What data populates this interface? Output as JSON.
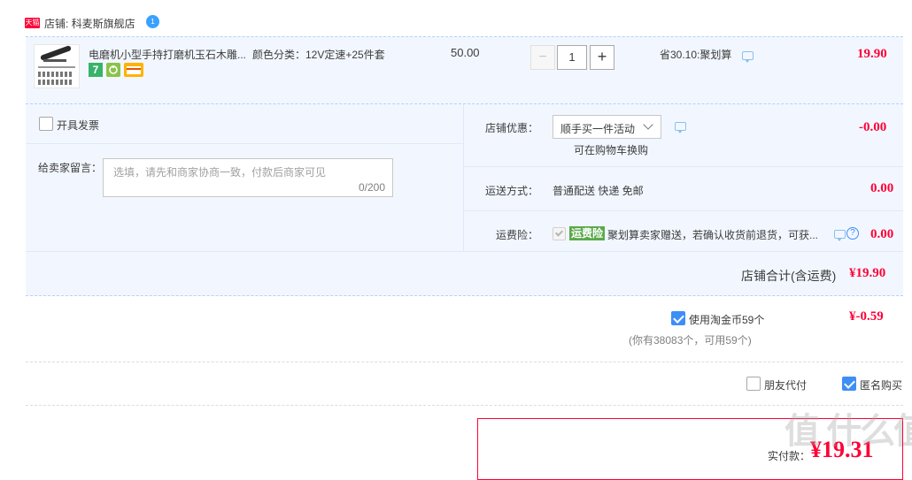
{
  "shop": {
    "badge": "天猫",
    "name": "店铺: 科麦斯旗舰店",
    "chat_bubble": "1"
  },
  "item": {
    "title": "电磨机小型手持打磨机玉石木雕...",
    "sku": "颜色分类：12V定速+25件套",
    "unit_price": "50.00",
    "quantity": "1",
    "minus": "−",
    "plus": "+",
    "promo": "省30.10:聚划算",
    "subtotal": "19.90",
    "service_badge_1": "7"
  },
  "invoice": {
    "label": "开具发票",
    "checked": false
  },
  "remark": {
    "label": "给卖家留言：",
    "placeholder": "选填，请先和商家协商一致，付款后商家可见",
    "counter": "0/200"
  },
  "shop_discount": {
    "label": "店铺优惠：",
    "selected": "顺手买一件活动",
    "note": "可在购物车换购",
    "amount": "-0.00"
  },
  "shipping": {
    "label": "运送方式：",
    "value": "普通配送 快递 免邮",
    "amount": "0.00"
  },
  "insurance": {
    "label": "运费险：",
    "tag": "运费险",
    "text": "聚划算卖家赠送，若确认收货前退货，可获...",
    "amount": "0.00",
    "help": "?"
  },
  "shop_total": {
    "label": "店铺合计(含运费)",
    "amount": "¥19.90"
  },
  "taobao_coin": {
    "label": "使用淘金币59个",
    "note": "(你有38083个，可用59个)",
    "amount": "¥-0.59",
    "checked": true
  },
  "options": {
    "friend_pay": "朋友代付",
    "friend_pay_checked": false,
    "anonymous": "匿名购买",
    "anonymous_checked": true
  },
  "pay": {
    "label": "实付款：",
    "amount": "¥19.31"
  },
  "watermark": "值 什么值得买",
  "colors": {
    "accent_red": "#ff0036",
    "light_blue_bg": "#f2f7ff",
    "dashed_border": "#b2d1ff",
    "check_blue": "#3e8ef7",
    "tag_green": "#5aa94b"
  }
}
